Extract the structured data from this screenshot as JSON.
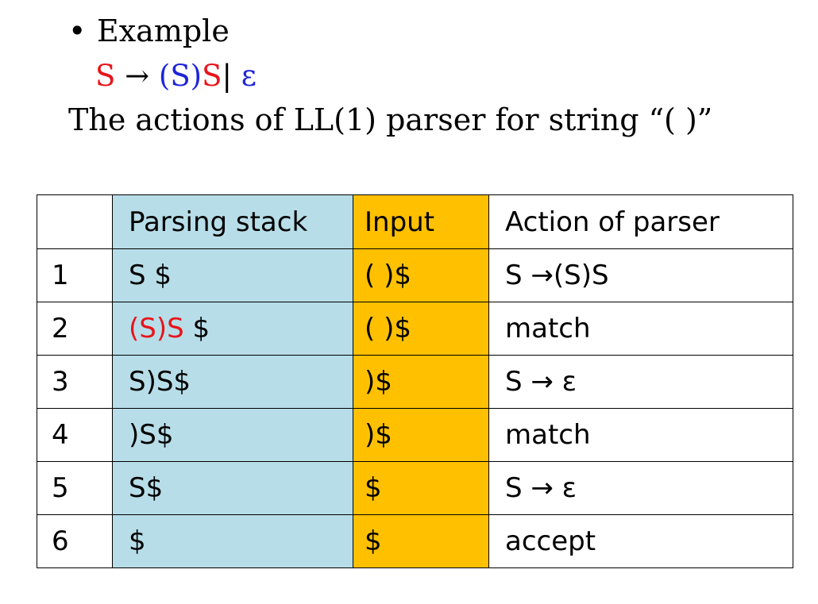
{
  "heading": {
    "bullet": "•",
    "title": "Example"
  },
  "grammar": {
    "lhs": "S",
    "arrow": " → ",
    "rhs_paren": "(S)",
    "rhs_s": "S",
    "bar": "| ",
    "epsilon": "ε"
  },
  "description": "The actions of LL(1) parser for string “( )”",
  "colors": {
    "lhs": "#e8141b",
    "rhs": "#1f24d9",
    "stack_column": "#b7dde8",
    "input_column": "#ffc000"
  },
  "table": {
    "headers": [
      "",
      "Parsing stack",
      "Input",
      "Action of parser"
    ],
    "rows": [
      {
        "step": "1",
        "stack_red": "",
        "stack": "S $",
        "input": "( )$",
        "action": "S →(S)S"
      },
      {
        "step": "2",
        "stack_red": "(S)S",
        "stack": " $",
        "input": "( )$",
        "action": "match"
      },
      {
        "step": "3",
        "stack_red": "",
        "stack": "S)S$",
        "input": ")$",
        "action": "S → ε"
      },
      {
        "step": "4",
        "stack_red": "",
        "stack": ")S$",
        "input": ")$",
        "action": "match"
      },
      {
        "step": "5",
        "stack_red": "",
        "stack": "S$",
        "input": "$",
        "action": "S → ε"
      },
      {
        "step": "6",
        "stack_red": "",
        "stack": "$",
        "input": "$",
        "action": "accept"
      }
    ]
  }
}
